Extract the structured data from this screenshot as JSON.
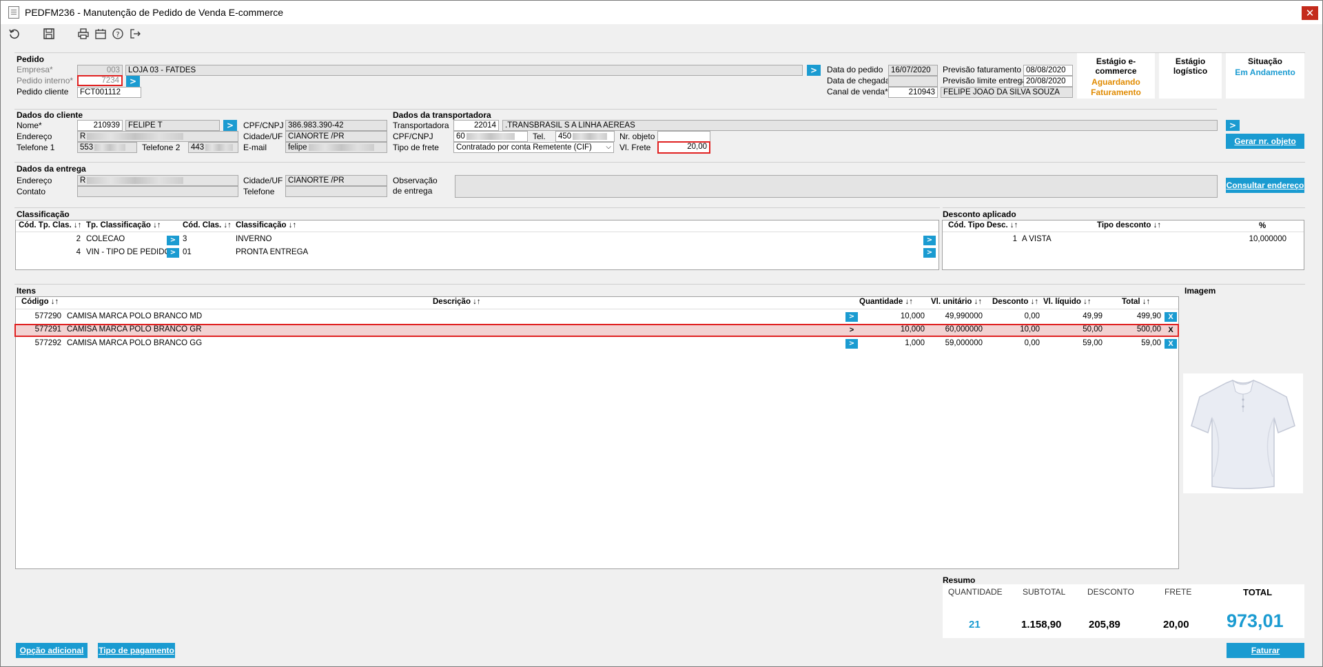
{
  "window": {
    "title": "PEDFM236 - Manutenção de Pedido de Venda E-commerce",
    "close": "✕"
  },
  "pedido": {
    "section": "Pedido",
    "empresa_label": "Empresa*",
    "empresa_code": "003",
    "empresa_name": "LOJA 03 - FATDES",
    "pedido_interno_label": "Pedido interno*",
    "pedido_interno": "7234",
    "pedido_cliente_label": "Pedido cliente",
    "pedido_cliente": "FCT001112",
    "data_pedido_label": "Data do pedido",
    "data_pedido": "16/07/2020",
    "data_chegada_label": "Data de chegada",
    "data_chegada": "",
    "canal_label": "Canal de venda*",
    "canal_code": "210943",
    "canal_name": "FELIPE JOAO DA SILVA SOUZA",
    "prev_fat_label": "Previsão faturamento",
    "prev_fat": "08/08/2020",
    "prev_lim_label": "Previsão limite entrega",
    "prev_lim": "20/08/2020"
  },
  "estagios": {
    "ecommerce_label": "Estágio e-commerce",
    "ecommerce_value_1": "Aguardando",
    "ecommerce_value_2": "Faturamento",
    "logistico_label": "Estágio logístico",
    "situacao_label": "Situação",
    "situacao_value": "Em Andamento"
  },
  "cliente": {
    "section": "Dados do cliente",
    "nome_label": "Nome*",
    "nome_code": "210939",
    "nome": "FELIPE T",
    "cpf_label": "CPF/CNPJ",
    "cpf": "386.983.390-42",
    "endereco_label": "Endereço",
    "endereco": "R",
    "cidade_label": "Cidade/UF",
    "cidade": "CIANORTE /PR",
    "tel1_label": "Telefone 1",
    "tel1": "553",
    "tel2_label": "Telefone 2",
    "tel2": "443",
    "email_label": "E-mail",
    "email": "felipe"
  },
  "transportadora": {
    "section": "Dados da transportadora",
    "label": "Transportadora",
    "code": "22014",
    "name": ".TRANSBRASIL S A LINHA AEREAS",
    "cpf_label": "CPF/CNPJ",
    "cpf": "60",
    "tel_label": "Tel.",
    "tel": "450",
    "nr_objeto_label": "Nr. objeto",
    "nr_objeto": "",
    "tipo_frete_label": "Tipo de frete",
    "tipo_frete": "Contratado por conta Remetente (CIF)",
    "vl_frete_label": "Vl. Frete",
    "vl_frete": "20,00",
    "gerar_btn": "Gerar nr. objeto"
  },
  "entrega": {
    "section": "Dados da entrega",
    "endereco_label": "Endereço",
    "endereco": "R",
    "cidade_label": "Cidade/UF",
    "cidade": "CIANORTE /PR",
    "contato_label": "Contato",
    "telefone_label": "Telefone",
    "obs_label_1": "Observação",
    "obs_label_2": "de entrega",
    "consultar_btn": "Consultar endereço"
  },
  "classificacao": {
    "section": "Classificação",
    "headers": [
      "Cód. Tp. Clas. ↓↑",
      "Tp. Classificação ↓↑",
      "Cód. Clas. ↓↑",
      "Classificação ↓↑"
    ],
    "rows": [
      {
        "cod_tp": "2",
        "tp": "COLECAO",
        "cod": "3",
        "clas": "INVERNO"
      },
      {
        "cod_tp": "4",
        "tp": "VIN - TIPO DE PEDIDO",
        "cod": "01",
        "clas": "PRONTA ENTREGA"
      }
    ]
  },
  "desconto": {
    "section": "Desconto aplicado",
    "headers": [
      "Cód. Tipo Desc. ↓↑",
      "Tipo desconto ↓↑",
      "%"
    ],
    "rows": [
      {
        "cod": "1",
        "tipo": "A VISTA",
        "pct": "10,000000"
      }
    ]
  },
  "itens": {
    "section": "Itens",
    "headers": [
      "Código ↓↑",
      "Descrição ↓↑",
      "Quantidade ↓↑",
      "Vl. unitário ↓↑",
      "Desconto ↓↑",
      "Vl. líquido ↓↑",
      "Total ↓↑"
    ],
    "rows": [
      {
        "codigo": "577290",
        "descricao": "CAMISA MARCA POLO BRANCO MD",
        "qtd": "10,000",
        "vl_unit": "49,990000",
        "desc": "0,00",
        "vl_liq": "49,99",
        "total": "499,90"
      },
      {
        "codigo": "577291",
        "descricao": "CAMISA MARCA POLO BRANCO GR",
        "qtd": "10,000",
        "vl_unit": "60,000000",
        "desc": "10,00",
        "vl_liq": "50,00",
        "total": "500,00"
      },
      {
        "codigo": "577292",
        "descricao": "CAMISA MARCA POLO BRANCO GG",
        "qtd": "1,000",
        "vl_unit": "59,000000",
        "desc": "0,00",
        "vl_liq": "59,00",
        "total": "59,00"
      }
    ],
    "remove_label": "X",
    "open_label": ">"
  },
  "imagem": {
    "section": "Imagem"
  },
  "resumo": {
    "section": "Resumo",
    "quantidade_label": "QUANTIDADE",
    "quantidade": "21",
    "subtotal_label": "SUBTOTAL",
    "subtotal": "1.158,90",
    "desconto_label": "DESCONTO",
    "desconto": "205,89",
    "frete_label": "FRETE",
    "frete": "20,00",
    "total_label": "TOTAL",
    "total": "973,01"
  },
  "footer": {
    "opcao_btn": "Opção adicional",
    "tipo_pag_btn": "Tipo de pagamento",
    "faturar_btn": "Faturar"
  },
  "colors": {
    "accent": "#1a9bd1",
    "warning": "#e08a00",
    "error_border": "#e02020"
  }
}
